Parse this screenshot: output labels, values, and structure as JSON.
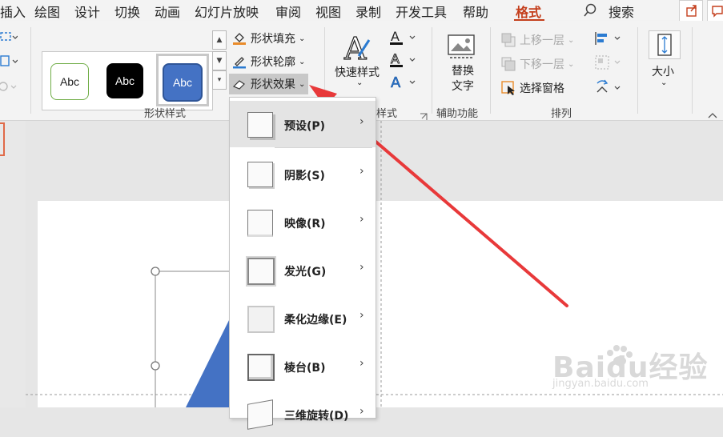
{
  "menu_tabs": [
    "插入",
    "绘图",
    "设计",
    "切换",
    "动画",
    "幻灯片放映",
    "审阅",
    "视图",
    "录制",
    "开发工具",
    "帮助",
    "格式"
  ],
  "active_tab": "格式",
  "search_label": "搜索",
  "shape_styles": {
    "swatch_labels": [
      "Abc",
      "Abc",
      "Abc"
    ],
    "group_label": "形状样式",
    "fill_label": "形状填充",
    "outline_label": "形状轮廓",
    "effects_label": "形状效果"
  },
  "wordart": {
    "quick_styles_label": "快速样式",
    "group_label": "样式"
  },
  "accessibility": {
    "alt_text_label": "替换文字",
    "group_label": "辅助功能"
  },
  "arrange": {
    "bring_forward_label": "上移一层",
    "send_backward_label": "下移一层",
    "selection_pane_label": "选择窗格",
    "group_label": "排列"
  },
  "size": {
    "label": "大小"
  },
  "effects_menu": [
    {
      "label": "预设(P)"
    },
    {
      "label": "阴影(S)"
    },
    {
      "label": "映像(R)"
    },
    {
      "label": "发光(G)"
    },
    {
      "label": "柔化边缘(E)"
    },
    {
      "label": "棱台(B)"
    },
    {
      "label": "三维旋转(D)"
    }
  ],
  "watermark": {
    "brand": "Baidu经验",
    "url": "jingyan.baidu.com"
  },
  "colors": {
    "accent": "#c43e1c",
    "arrow": "#e8393a",
    "shape_fill": "#4472c4"
  }
}
